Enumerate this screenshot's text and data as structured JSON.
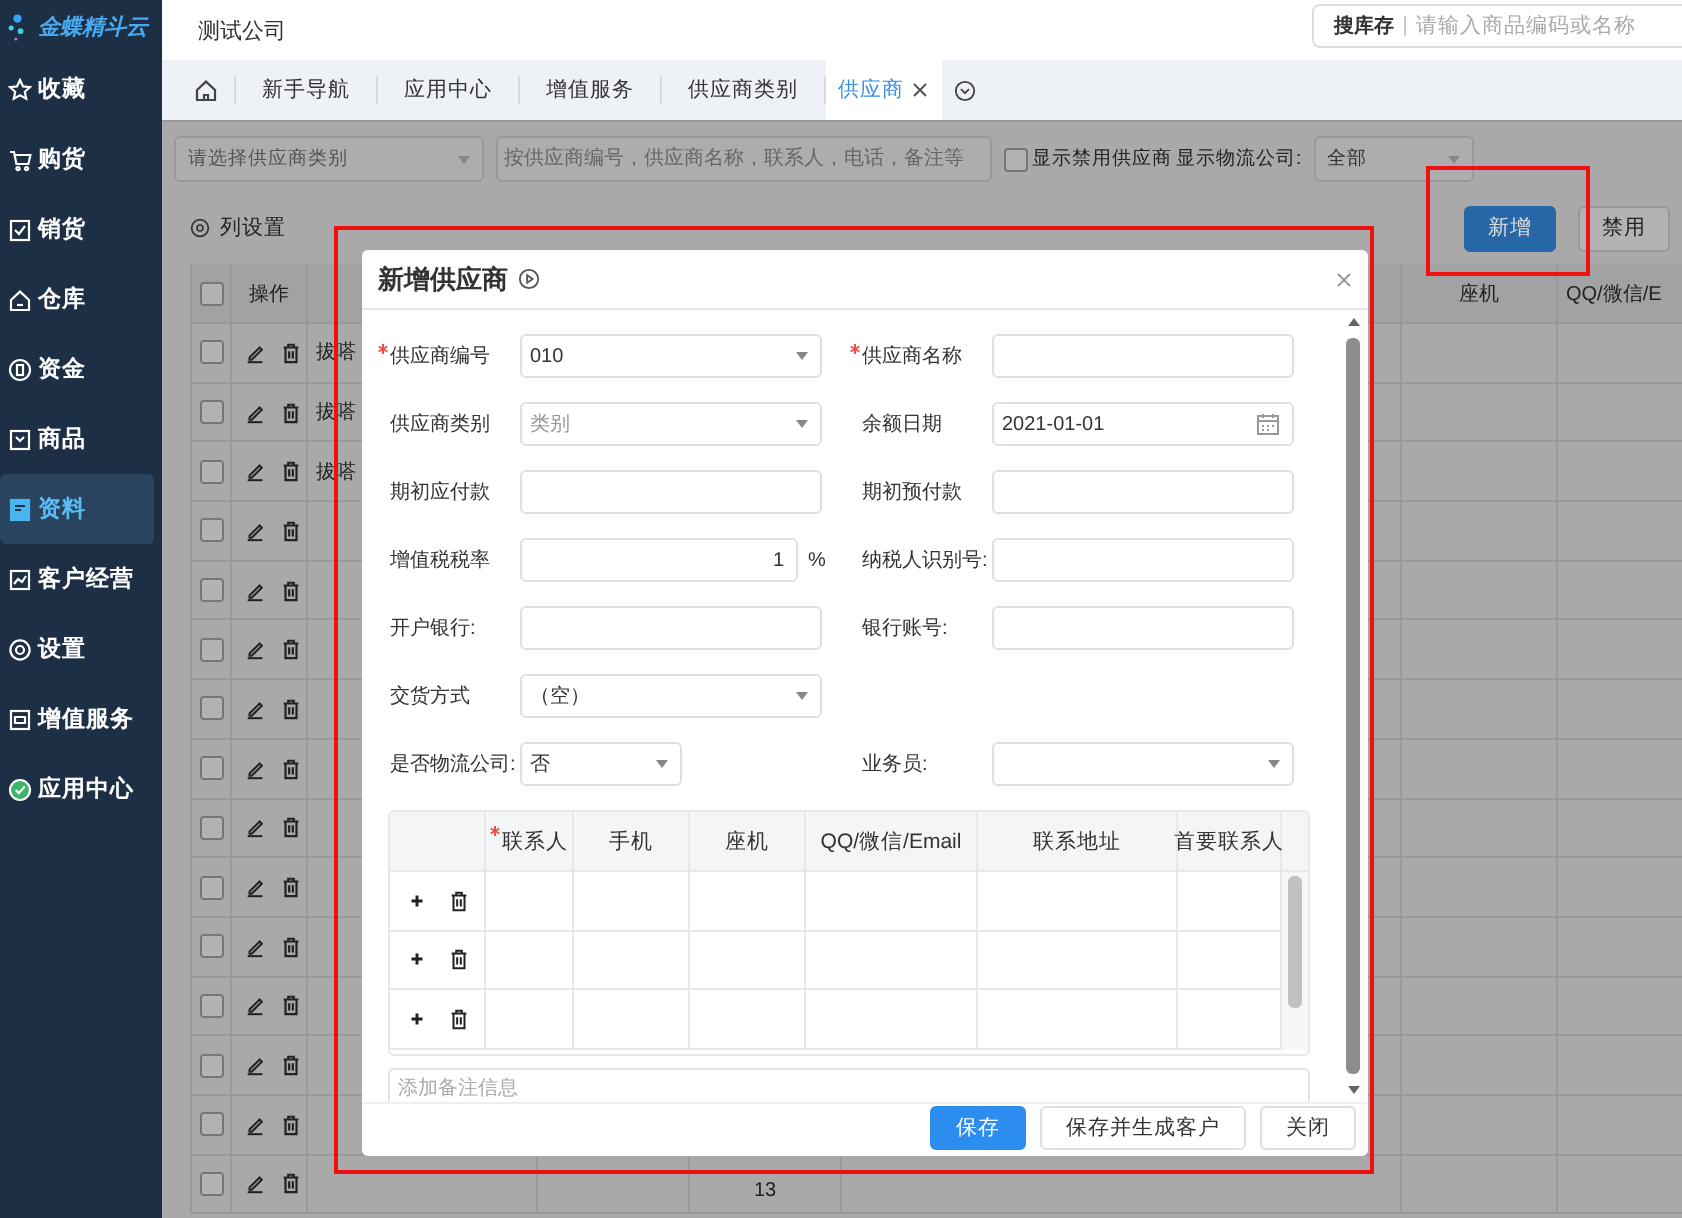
{
  "sidebar": {
    "logo": "金蝶精斗云",
    "items": [
      {
        "label": "收藏",
        "selected": false
      },
      {
        "label": "购货",
        "selected": false
      },
      {
        "label": "销货",
        "selected": false
      },
      {
        "label": "仓库",
        "selected": false
      },
      {
        "label": "资金",
        "selected": false
      },
      {
        "label": "商品",
        "selected": false
      },
      {
        "label": "资料",
        "selected": true
      },
      {
        "label": "客户经营",
        "selected": false
      },
      {
        "label": "设置",
        "selected": false
      },
      {
        "label": "增值服务",
        "selected": false
      },
      {
        "label": "应用中心",
        "selected": false
      }
    ]
  },
  "header": {
    "company": "测试公司",
    "search": {
      "label": "搜库存",
      "placeholder": "请输入商品编码或名称"
    }
  },
  "tabs": [
    {
      "label": "新手导航",
      "selected": false,
      "closable": false
    },
    {
      "label": "应用中心",
      "selected": false,
      "closable": false
    },
    {
      "label": "增值服务",
      "selected": false,
      "closable": false
    },
    {
      "label": "供应商类别",
      "selected": false,
      "closable": false
    },
    {
      "label": "供应商",
      "selected": true,
      "closable": true
    }
  ],
  "filters": {
    "category": {
      "placeholder": "请选择供应商类别"
    },
    "search": {
      "placeholder": "按供应商编号，供应商名称，联系人，电话，备注等"
    },
    "show_disabled": {
      "label": "显示禁用供应商",
      "checked": false
    },
    "logistics": {
      "label": "显示物流公司:",
      "value": "全部"
    }
  },
  "column_settings": "列设置",
  "actions": [
    {
      "label": "新增",
      "kind": "primary"
    },
    {
      "label": "禁用",
      "kind": "default"
    }
  ],
  "table": {
    "select_all_checked": false,
    "columns": [
      "操作",
      "座机",
      "QQ/微信/E"
    ],
    "rows": [
      {
        "checked": false,
        "column_3": "拔嗒"
      },
      {
        "checked": false,
        "column_3": "拔嗒"
      },
      {
        "checked": false,
        "column_3": "拔嗒"
      },
      {
        "checked": false
      },
      {
        "checked": false
      },
      {
        "checked": false
      },
      {
        "checked": false
      },
      {
        "checked": false
      },
      {
        "checked": false
      },
      {
        "checked": false
      },
      {
        "checked": false
      },
      {
        "checked": false
      },
      {
        "checked": false
      },
      {
        "checked": false
      },
      {
        "checked": false,
        "column_5": "13"
      }
    ]
  },
  "dialog": {
    "title": "新增供应商",
    "rows": [
      [
        {
          "label": "供应商编号",
          "required": true,
          "kind": "select",
          "value": "010"
        },
        {
          "label": "供应商名称",
          "required": true,
          "kind": "input"
        }
      ],
      [
        {
          "label": "供应商类别",
          "required": false,
          "kind": "select",
          "placeholder": "类别"
        },
        {
          "label": "余额日期",
          "required": false,
          "kind": "date",
          "value": "2021-01-01"
        }
      ],
      [
        {
          "label": "期初应付款",
          "required": false,
          "kind": "input"
        },
        {
          "label": "期初预付款",
          "required": false,
          "kind": "input"
        }
      ],
      [
        {
          "label": "增值税税率",
          "required": false,
          "kind": "percent",
          "value": "1",
          "unit": "%"
        },
        {
          "label": "纳税人识别号:",
          "required": false,
          "kind": "input"
        }
      ],
      [
        {
          "label": "开户银行:",
          "required": false,
          "kind": "input"
        },
        {
          "label": "银行账号:",
          "required": false,
          "kind": "input"
        }
      ],
      [
        {
          "label": "交货方式",
          "required": false,
          "kind": "select",
          "value": "（空）"
        }
      ],
      [
        {
          "label": "是否物流公司:",
          "required": false,
          "kind": "short-select",
          "value": "否"
        },
        {
          "label": "业务员:",
          "required": false,
          "kind": "select"
        }
      ]
    ],
    "contacts": {
      "columns": [
        {
          "label": "联系人",
          "required": true
        },
        {
          "label": "手机",
          "required": false
        },
        {
          "label": "座机",
          "required": false
        },
        {
          "label": "QQ/微信/Email",
          "required": false
        },
        {
          "label": "联系地址",
          "required": false
        },
        {
          "label": "首要联系人",
          "required": false
        }
      ]
    },
    "remark": {
      "placeholder": "添加备注信息"
    },
    "buttons": [
      {
        "label": "保存",
        "kind": "primary"
      },
      {
        "label": "保存并生成客户",
        "kind": "default"
      },
      {
        "label": "关闭",
        "kind": "default"
      }
    ]
  }
}
